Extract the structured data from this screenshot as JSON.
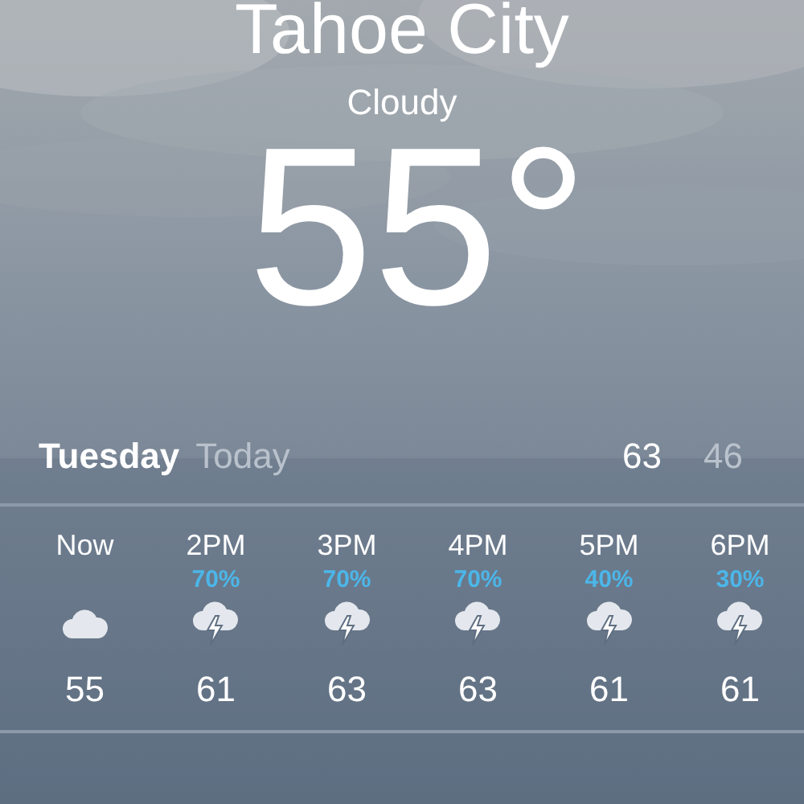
{
  "location": {
    "city": "Tahoe City",
    "condition": "Cloudy",
    "temperature": "55°"
  },
  "day": {
    "name": "Tuesday",
    "label": "Today",
    "high": "63",
    "low": "46"
  },
  "hours": [
    {
      "time": "Now",
      "kind": "cloudy",
      "temp": "55"
    },
    {
      "time": "2PM",
      "chance": "70%",
      "kind": "thunderstorm",
      "temp": "61"
    },
    {
      "time": "3PM",
      "chance": "70%",
      "kind": "thunderstorm",
      "temp": "63"
    },
    {
      "time": "4PM",
      "chance": "70%",
      "kind": "thunderstorm",
      "temp": "63"
    },
    {
      "time": "5PM",
      "chance": "40%",
      "kind": "thunderstorm",
      "temp": "61"
    },
    {
      "time": "6PM",
      "chance": "30%",
      "kind": "thunderstorm",
      "temp": "61"
    }
  ]
}
